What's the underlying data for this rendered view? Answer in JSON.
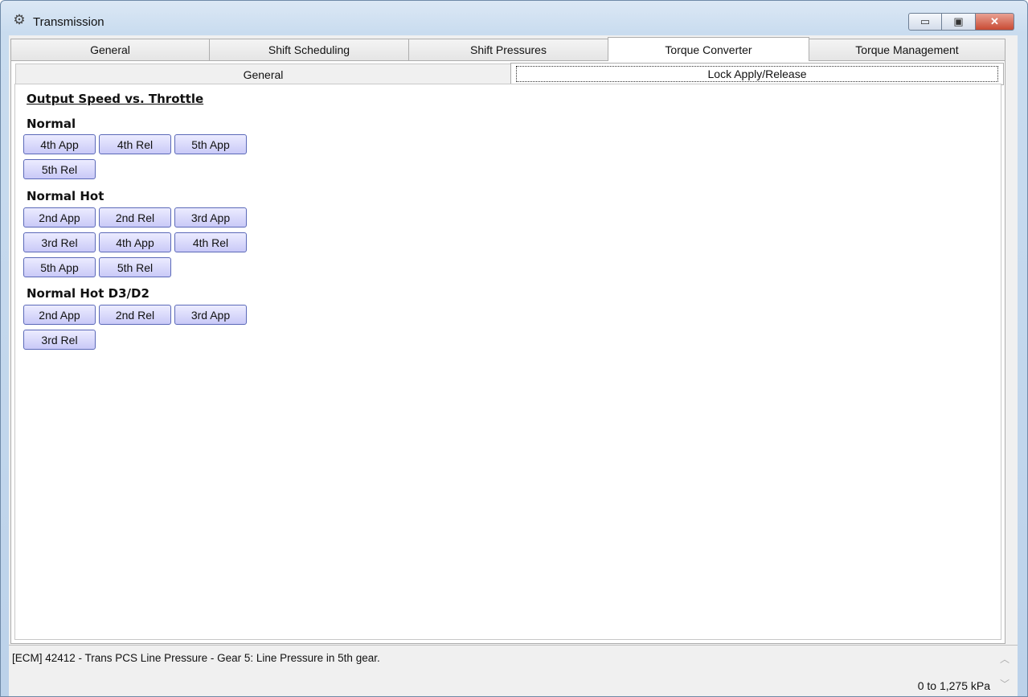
{
  "window": {
    "title": "Transmission",
    "icon": "gear-icon",
    "buttons": {
      "minimize": "▭",
      "maximize": "▣",
      "close": "✕"
    }
  },
  "tabs": [
    {
      "label": "General",
      "active": false
    },
    {
      "label": "Shift Scheduling",
      "active": false
    },
    {
      "label": "Shift Pressures",
      "active": false
    },
    {
      "label": "Torque Converter",
      "active": true
    },
    {
      "label": "Torque Management",
      "active": false
    }
  ],
  "subtabs": [
    {
      "label": "General",
      "active": false
    },
    {
      "label": "Lock Apply/Release",
      "active": true
    }
  ],
  "panel": {
    "title": "Output Speed vs. Throttle",
    "groups": [
      {
        "label": "Normal",
        "buttons": [
          "4th App",
          "4th Rel",
          "5th App",
          "5th Rel"
        ]
      },
      {
        "label": "Normal Hot",
        "buttons": [
          "2nd App",
          "2nd Rel",
          "3rd App",
          "3rd Rel",
          "4th App",
          "4th Rel",
          "5th App",
          "5th Rel"
        ]
      },
      {
        "label": "Normal Hot D3/D2",
        "buttons": [
          "2nd App",
          "2nd Rel",
          "3rd App",
          "3rd Rel"
        ]
      }
    ]
  },
  "status": {
    "description": "[ECM] 42412 - Trans PCS Line Pressure - Gear 5: Line Pressure in 5th gear.",
    "range": "0 to 1,275 kPa",
    "scroll_up": "︿",
    "scroll_down": "﹀"
  }
}
